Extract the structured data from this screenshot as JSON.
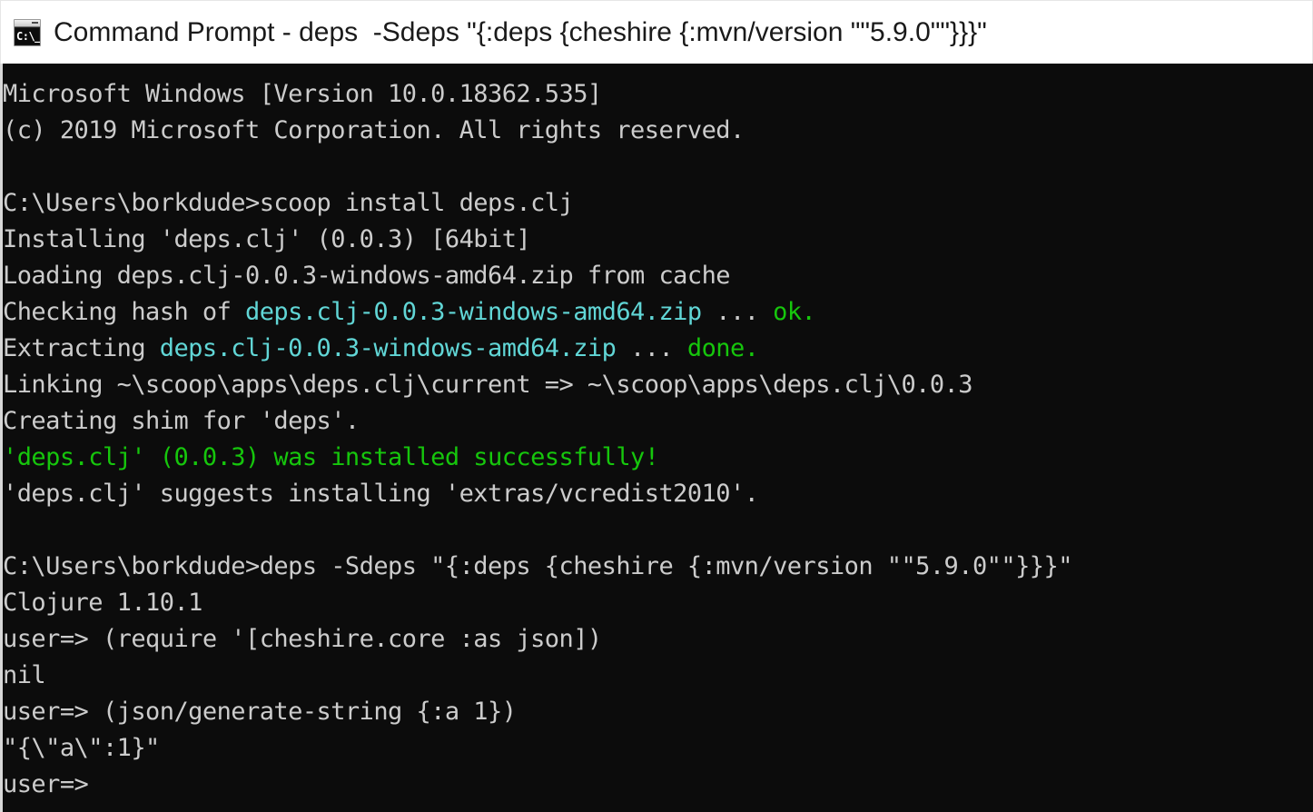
{
  "window": {
    "title": "Command Prompt - deps  -Sdeps \"{:deps {cheshire {:mvn/version \"\"5.9.0\"\"}}}\"",
    "icon": "cmd-icon",
    "icon_glyph": "C:\\_",
    "background": "#ffffff"
  },
  "terminal": {
    "background": "#0c0c0c",
    "foreground": "#cccccc",
    "colors": {
      "default": "#cccccc",
      "cyan": "#61d6d6",
      "green": "#16c60c"
    },
    "lines": [
      [
        {
          "t": "Microsoft Windows [Version 10.0.18362.535]",
          "c": "default"
        }
      ],
      [
        {
          "t": "(c) 2019 Microsoft Corporation. All rights reserved.",
          "c": "default"
        }
      ],
      [
        {
          "t": "",
          "c": "default"
        }
      ],
      [
        {
          "t": "C:\\Users\\borkdude>scoop install deps.clj",
          "c": "default"
        }
      ],
      [
        {
          "t": "Installing 'deps.clj' (0.0.3) [64bit]",
          "c": "default"
        }
      ],
      [
        {
          "t": "Loading deps.clj-0.0.3-windows-amd64.zip from cache",
          "c": "default"
        }
      ],
      [
        {
          "t": "Checking hash of ",
          "c": "default"
        },
        {
          "t": "deps.clj-0.0.3-windows-amd64.zip",
          "c": "cyan"
        },
        {
          "t": " ... ",
          "c": "default"
        },
        {
          "t": "ok.",
          "c": "green"
        }
      ],
      [
        {
          "t": "Extracting ",
          "c": "default"
        },
        {
          "t": "deps.clj-0.0.3-windows-amd64.zip",
          "c": "cyan"
        },
        {
          "t": " ... ",
          "c": "default"
        },
        {
          "t": "done.",
          "c": "green"
        }
      ],
      [
        {
          "t": "Linking ~\\scoop\\apps\\deps.clj\\current => ~\\scoop\\apps\\deps.clj\\0.0.3",
          "c": "default"
        }
      ],
      [
        {
          "t": "Creating shim for 'deps'.",
          "c": "default"
        }
      ],
      [
        {
          "t": "'deps.clj' (0.0.3) was installed successfully!",
          "c": "green"
        }
      ],
      [
        {
          "t": "'deps.clj' suggests installing 'extras/vcredist2010'.",
          "c": "default"
        }
      ],
      [
        {
          "t": "",
          "c": "default"
        }
      ],
      [
        {
          "t": "C:\\Users\\borkdude>deps -Sdeps \"{:deps {cheshire {:mvn/version \"\"5.9.0\"\"}}}\"",
          "c": "default"
        }
      ],
      [
        {
          "t": "Clojure 1.10.1",
          "c": "default"
        }
      ],
      [
        {
          "t": "user=> (require '[cheshire.core :as json])",
          "c": "default"
        }
      ],
      [
        {
          "t": "nil",
          "c": "default"
        }
      ],
      [
        {
          "t": "user=> (json/generate-string {:a 1})",
          "c": "default"
        }
      ],
      [
        {
          "t": "\"{\\\"a\\\":1}\"",
          "c": "default"
        }
      ],
      [
        {
          "t": "user=>",
          "c": "default"
        }
      ]
    ]
  }
}
